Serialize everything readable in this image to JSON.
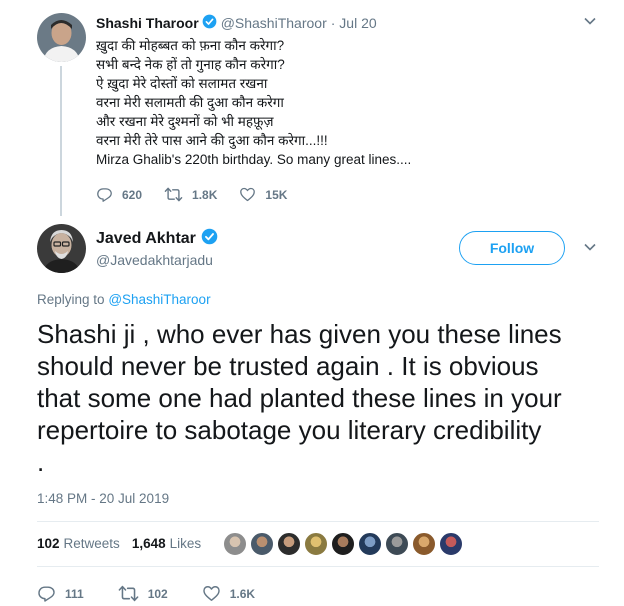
{
  "parent_tweet": {
    "author_name": "Shashi Tharoor",
    "handle": "@ShashiTharoor",
    "date": "· Jul 20",
    "lines": [
      "ख़ुदा की मोहब्बत को फ़ना कौन करेगा?",
      "सभी बन्दे नेक हों तो गुनाह कौन करेगा?",
      "ऐ ख़ुदा मेरे दोस्तों को सलामत रखना",
      "वरना मेरी सलामती की दुआ कौन करेगा",
      "और रखना मेरे दुश्मनों को भी महफ़ूज़",
      "वरना मेरी तेरे पास आने की दुआ कौन करेगा...!!!",
      "Mirza Ghalib's 220th birthday. So many great lines...."
    ],
    "replies": "620",
    "retweets": "1.8K",
    "likes": "15K"
  },
  "main_tweet": {
    "author_name": "Javed Akhtar",
    "handle": "@Javedakhtarjadu",
    "follow_label": "Follow",
    "replying_prefix": "Replying to",
    "replying_to": "@ShashiTharoor",
    "text_lines": [
      "Shashi ji , who ever has given you these lines",
      "should never be trusted again . It is obvious",
      "that some one had planted these lines in your",
      "repertoire to sabotage you literary credibility",
      "."
    ],
    "timestamp": "1:48 PM - 20 Jul 2019",
    "retweet_count": "102",
    "retweet_label": "Retweets",
    "like_count": "1,648",
    "like_label": "Likes",
    "replies": "111",
    "retweets": "102",
    "likes": "1.6K"
  },
  "colors": {
    "accent": "#1da1f2",
    "text": "#14171a",
    "muted": "#657786",
    "divider": "#e6ecf0"
  },
  "icons": [
    "verified-badge-icon",
    "chevron-down-icon",
    "reply-icon",
    "retweet-icon",
    "like-icon"
  ]
}
